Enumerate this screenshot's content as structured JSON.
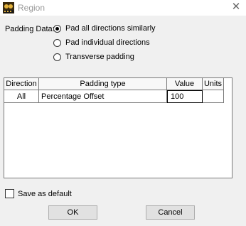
{
  "window": {
    "title": "Region",
    "app_icon": "edit-app-icon",
    "close_icon": "close-icon"
  },
  "padding": {
    "label": "Padding Data:",
    "options": [
      {
        "label": "Pad all directions similarly",
        "selected": true
      },
      {
        "label": "Pad individual directions",
        "selected": false
      },
      {
        "label": "Transverse padding",
        "selected": false
      }
    ]
  },
  "table": {
    "columns": [
      "Direction",
      "Padding type",
      "Value",
      "Units"
    ],
    "rows": [
      {
        "direction": "All",
        "padding_type": "Percentage Offset",
        "value": "100",
        "units": ""
      }
    ]
  },
  "save_default": {
    "label": "Save as default",
    "checked": false
  },
  "buttons": {
    "ok": "OK",
    "cancel": "Cancel"
  }
}
